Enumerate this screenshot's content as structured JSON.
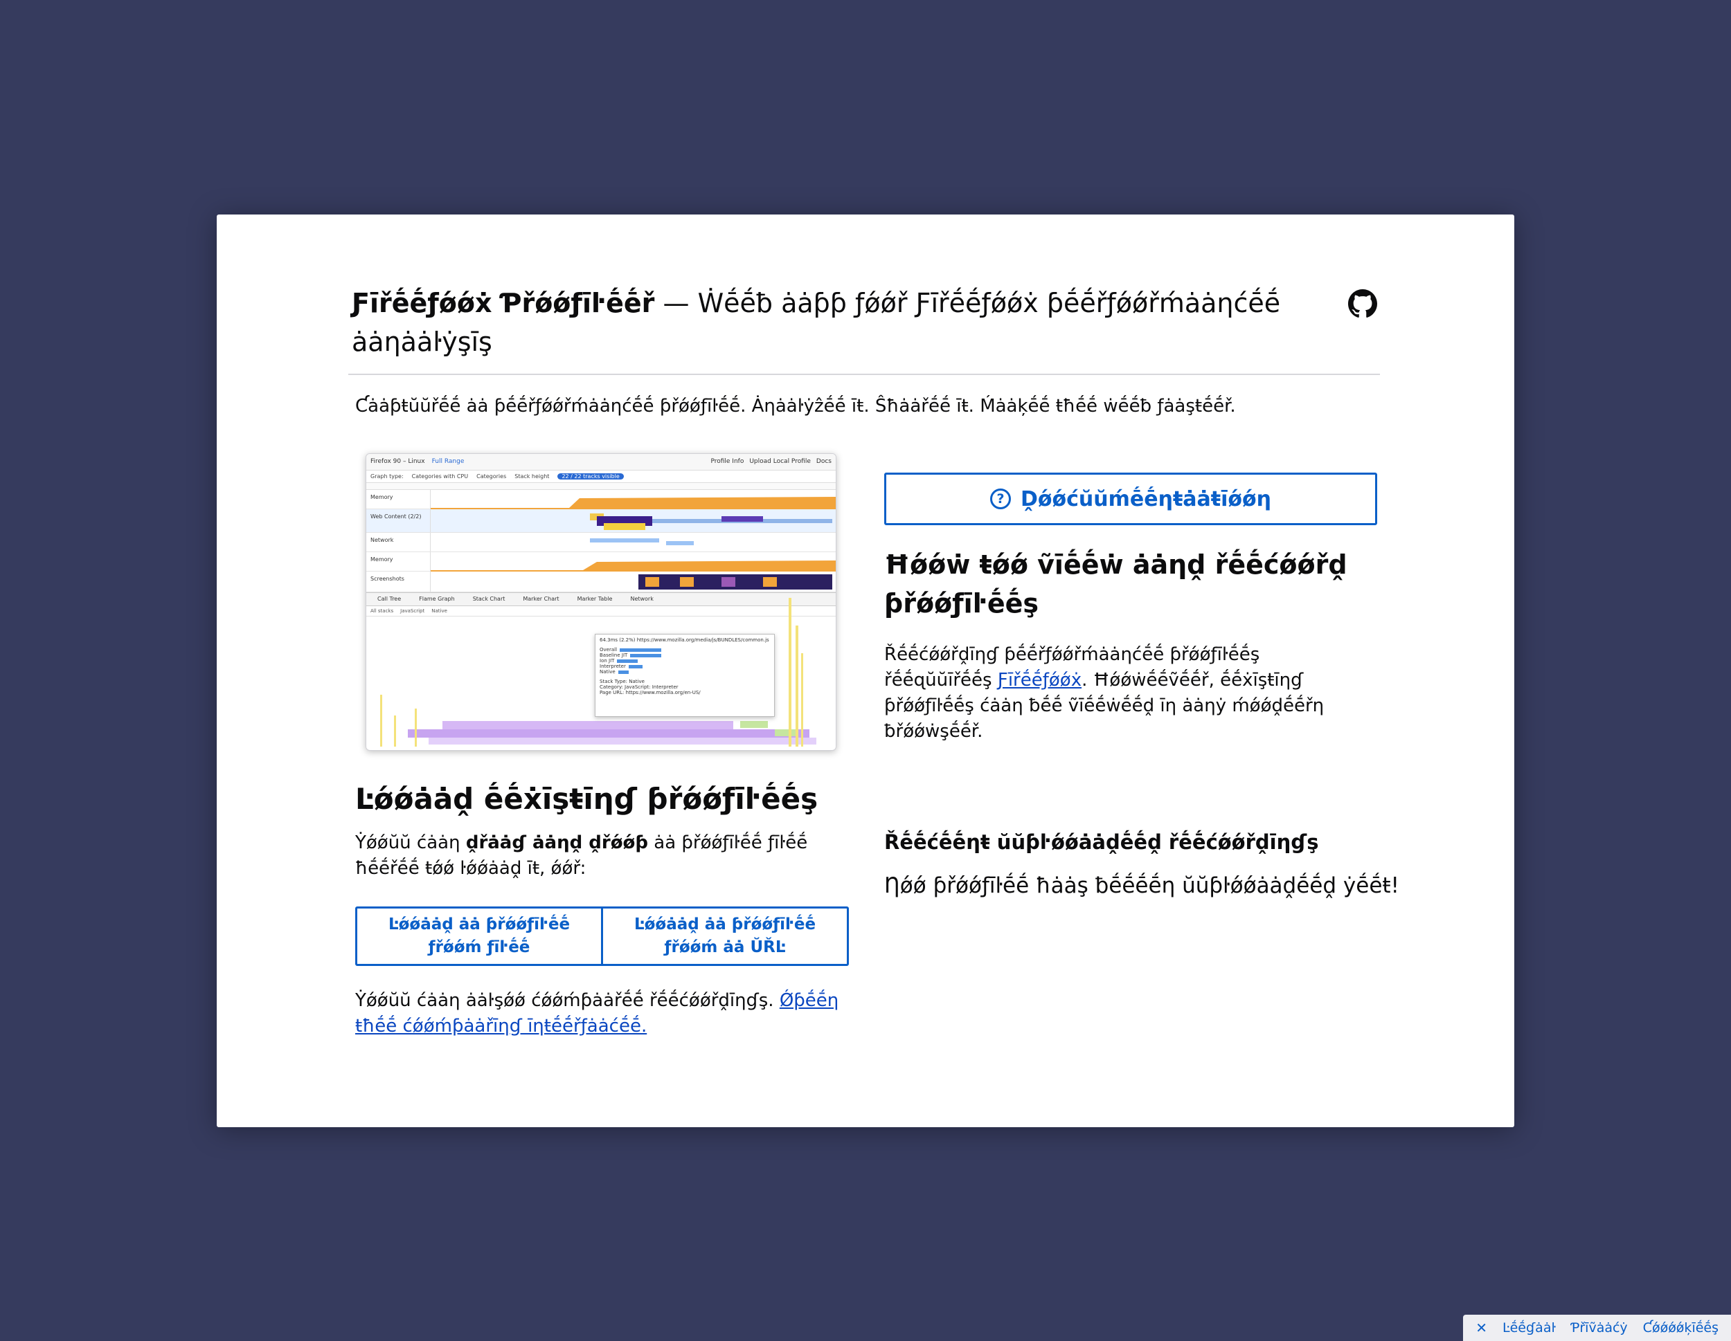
{
  "header": {
    "title_strong": "Ƒīřḗḗƒǿǿẋ Ƥřǿǿƒīŀḗḗř",
    "title_rest": " — Ẇḗḗƀ ȧȧƥƥ ƒǿǿř Ƒīřḗḗƒǿǿẋ ƥḗḗřƒǿǿřḿȧȧƞćḗḗ ȧȧƞȧȧŀẏşīş"
  },
  "tagline": "Ƈȧȧƥŧŭŭřḗḗ ȧȧ ƥḗḗřƒǿǿřḿȧȧƞćḗḗ ƥřǿǿƒīŀḗḗ. Ȧƞȧȧŀẏẑḗḗ īŧ. Ŝħȧȧřḗḗ īŧ. Ḿȧȧķḗḗ ŧħḗḗ ẇḗḗƀ ƒȧȧşŧḗḗř.",
  "screenshot": {
    "top_title": "Firefox 90 – Linux",
    "top_range": "Full Range",
    "top_profile_info": "Profile Info",
    "top_upload": "Upload Local Profile",
    "top_docs": "Docs",
    "opts": [
      "Graph type:",
      "Categories with CPU",
      "Categories",
      "Stack height"
    ],
    "opts_pill": "22 / 22 tracks visible",
    "tracks": [
      "Memory",
      "Web Content (2/2)",
      "Network",
      "Memory",
      "Screenshots"
    ],
    "tabs": [
      "Call Tree",
      "Flame Graph",
      "Stack Chart",
      "Marker Chart",
      "Marker Table",
      "Network"
    ],
    "sub": [
      "All stacks",
      "JavaScript",
      "Native"
    ],
    "tooltip_title": "64.3ms (2.2%)  https://www.mozilla.org/media/js/BUNDLES/common.js",
    "tooltip_rows": [
      "Overall",
      "Baseline JIT",
      "Ion JIT",
      "Interpreter",
      "Native"
    ],
    "tooltip_meta": [
      "Stack Type: Native",
      "Category: JavaScript: Interpreter",
      "Page URL: https://www.mozilla.org/en-US/"
    ]
  },
  "doc_button": {
    "label": "Ḓǿǿćŭŭḿḗḗƞŧȧȧŧīǿǿƞ"
  },
  "howto": {
    "heading": "Ħǿǿẇ ŧǿǿ ṽīḗḗẇ ȧȧƞḓ řḗḗćǿǿřḓ ƥřǿǿƒīŀḗḗş",
    "text_before": "Řḗḗćǿǿřḓīƞɠ ƥḗḗřƒǿǿřḿȧȧƞćḗḗ ƥřǿǿƒīŀḗḗş řḗḗɋŭŭīřḗḗş ",
    "link": "Ƒīřḗḗƒǿǿẋ",
    "text_after": ". Ħǿǿẇḗḗṽḗḗř, ḗḗẋīşŧīƞɠ ƥřǿǿƒīŀḗḗş ćȧȧƞ ƀḗḗ ṽīḗḗẇḗḗḓ īƞ ȧȧƞẏ ḿǿǿḓḗḗřƞ ƀřǿǿẇşḗḗř."
  },
  "load": {
    "heading": "Ŀǿǿȧȧḓ ḗḗẋīşŧīƞɠ ƥřǿǿƒīŀḗḗş",
    "text_before": "Ẏǿǿŭŭ ćȧȧƞ ",
    "text_bold": "ḓřȧȧɠ ȧȧƞḓ ḓřǿǿƥ",
    "text_after": " ȧȧ ƥřǿǿƒīŀḗḗ ƒīŀḗḗ ħḗḗřḗḗ ŧǿǿ ŀǿǿȧȧḓ īŧ, ǿǿř:",
    "button_file": "Ŀǿǿȧȧḓ ȧȧ ƥřǿǿƒīŀḗḗ ƒřǿǿḿ ƒīŀḗḗ",
    "button_url": "Ŀǿǿȧȧḓ ȧȧ ƥřǿǿƒīŀḗḗ ƒřǿǿḿ ȧȧ ŬŘĿ",
    "compare_before": "Ẏǿǿŭŭ ćȧȧƞ ȧȧŀşǿǿ ćǿǿḿƥȧȧřḗḗ řḗḗćǿǿřḓīƞɠş. ",
    "compare_link": "Ǿƥḗḗƞ ŧħḗḗ ćǿǿḿƥȧȧřīƞɠ īƞŧḗḗřƒȧȧćḗḗ."
  },
  "recent": {
    "heading": "Řḗḗćḗḗƞŧ ŭŭƥŀǿǿȧȧḓḗḗḓ řḗḗćǿǿřḓīƞɠş",
    "text": "Ƞǿǿ ƥřǿǿƒīŀḗḗ ħȧȧş ƀḗḗḗḗƞ ŭŭƥŀǿǿȧȧḓḗḗḓ ẏḗḗŧ!"
  },
  "footer": {
    "close": "✕",
    "legal": "Ŀḗḗɠȧȧŀ",
    "privacy": "Ƥřīṽȧȧćẏ",
    "cookies": "Ƈǿǿǿǿķīḗḗş"
  },
  "colors": {
    "background": "#363b5e",
    "accent": "#0a5fc8",
    "link": "#0a46c0"
  }
}
